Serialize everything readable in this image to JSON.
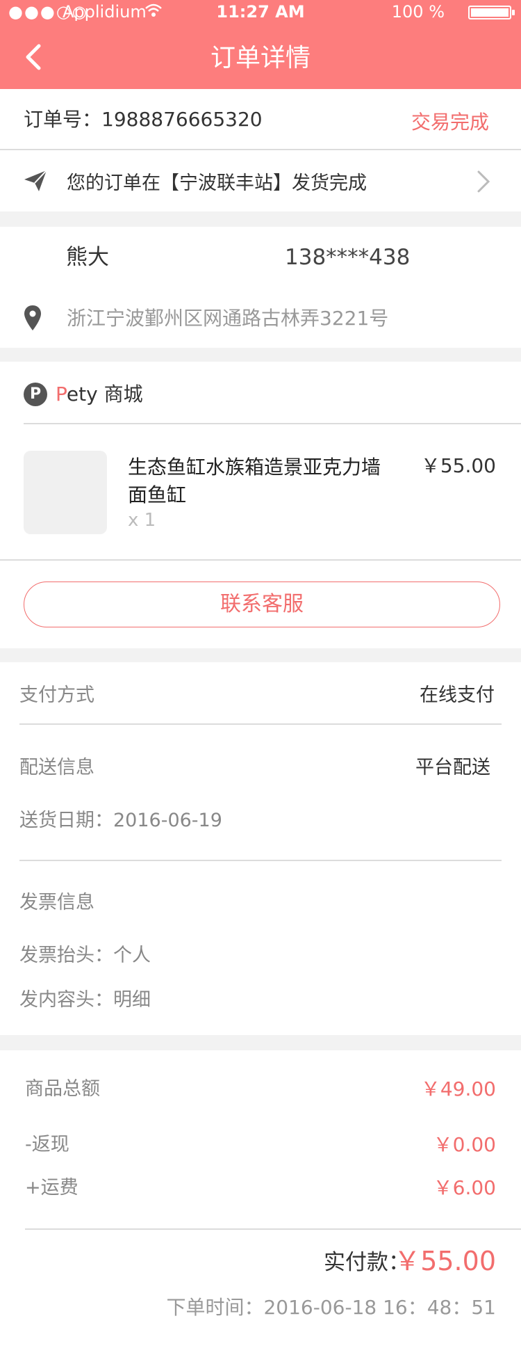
{
  "status_bar": {
    "signal": "●●●○○",
    "carrier": "Applidium",
    "time": "11:27 AM",
    "battery": "100 %"
  },
  "header": {
    "title": "订单详情"
  },
  "order": {
    "number": "订单号：1988876665320",
    "status": "交易完成"
  },
  "logistics": {
    "text": "您的订单在【宁波联丰站】发货完成"
  },
  "address": {
    "name": "熊大",
    "phone": "138****438",
    "detail": "浙江宁波鄞州区网通路古林弄3221号"
  },
  "shop": {
    "icon_letter": "P",
    "name_first": "P",
    "name_rest": "ety 商城"
  },
  "product": {
    "name": "生态鱼缸水族箱造景亚克力墙面鱼缸",
    "qty": "x 1",
    "price": "￥55.00"
  },
  "contact_label": "联系客服",
  "payment": {
    "label": "支付方式",
    "value": "在线支付"
  },
  "delivery": {
    "label": "配送信息",
    "value": "平台配送",
    "date": "送货日期：2016-06-19"
  },
  "invoice": {
    "label": "发票信息",
    "title": "发票抬头：个人",
    "content": "发内容头：明细"
  },
  "summary": {
    "goods_label": "商品总额",
    "goods_value": "￥49.00",
    "cashback_label": "-返现",
    "cashback_value": "￥0.00",
    "freight_label": "+运费",
    "freight_value": "￥6.00",
    "paid_label": "实付款：",
    "paid_value": "￥55.00",
    "order_time": "下单时间：2016-06-18 16：48：51"
  },
  "colors": {
    "accent": "#fd7d7d",
    "price": "#f26d6d"
  }
}
